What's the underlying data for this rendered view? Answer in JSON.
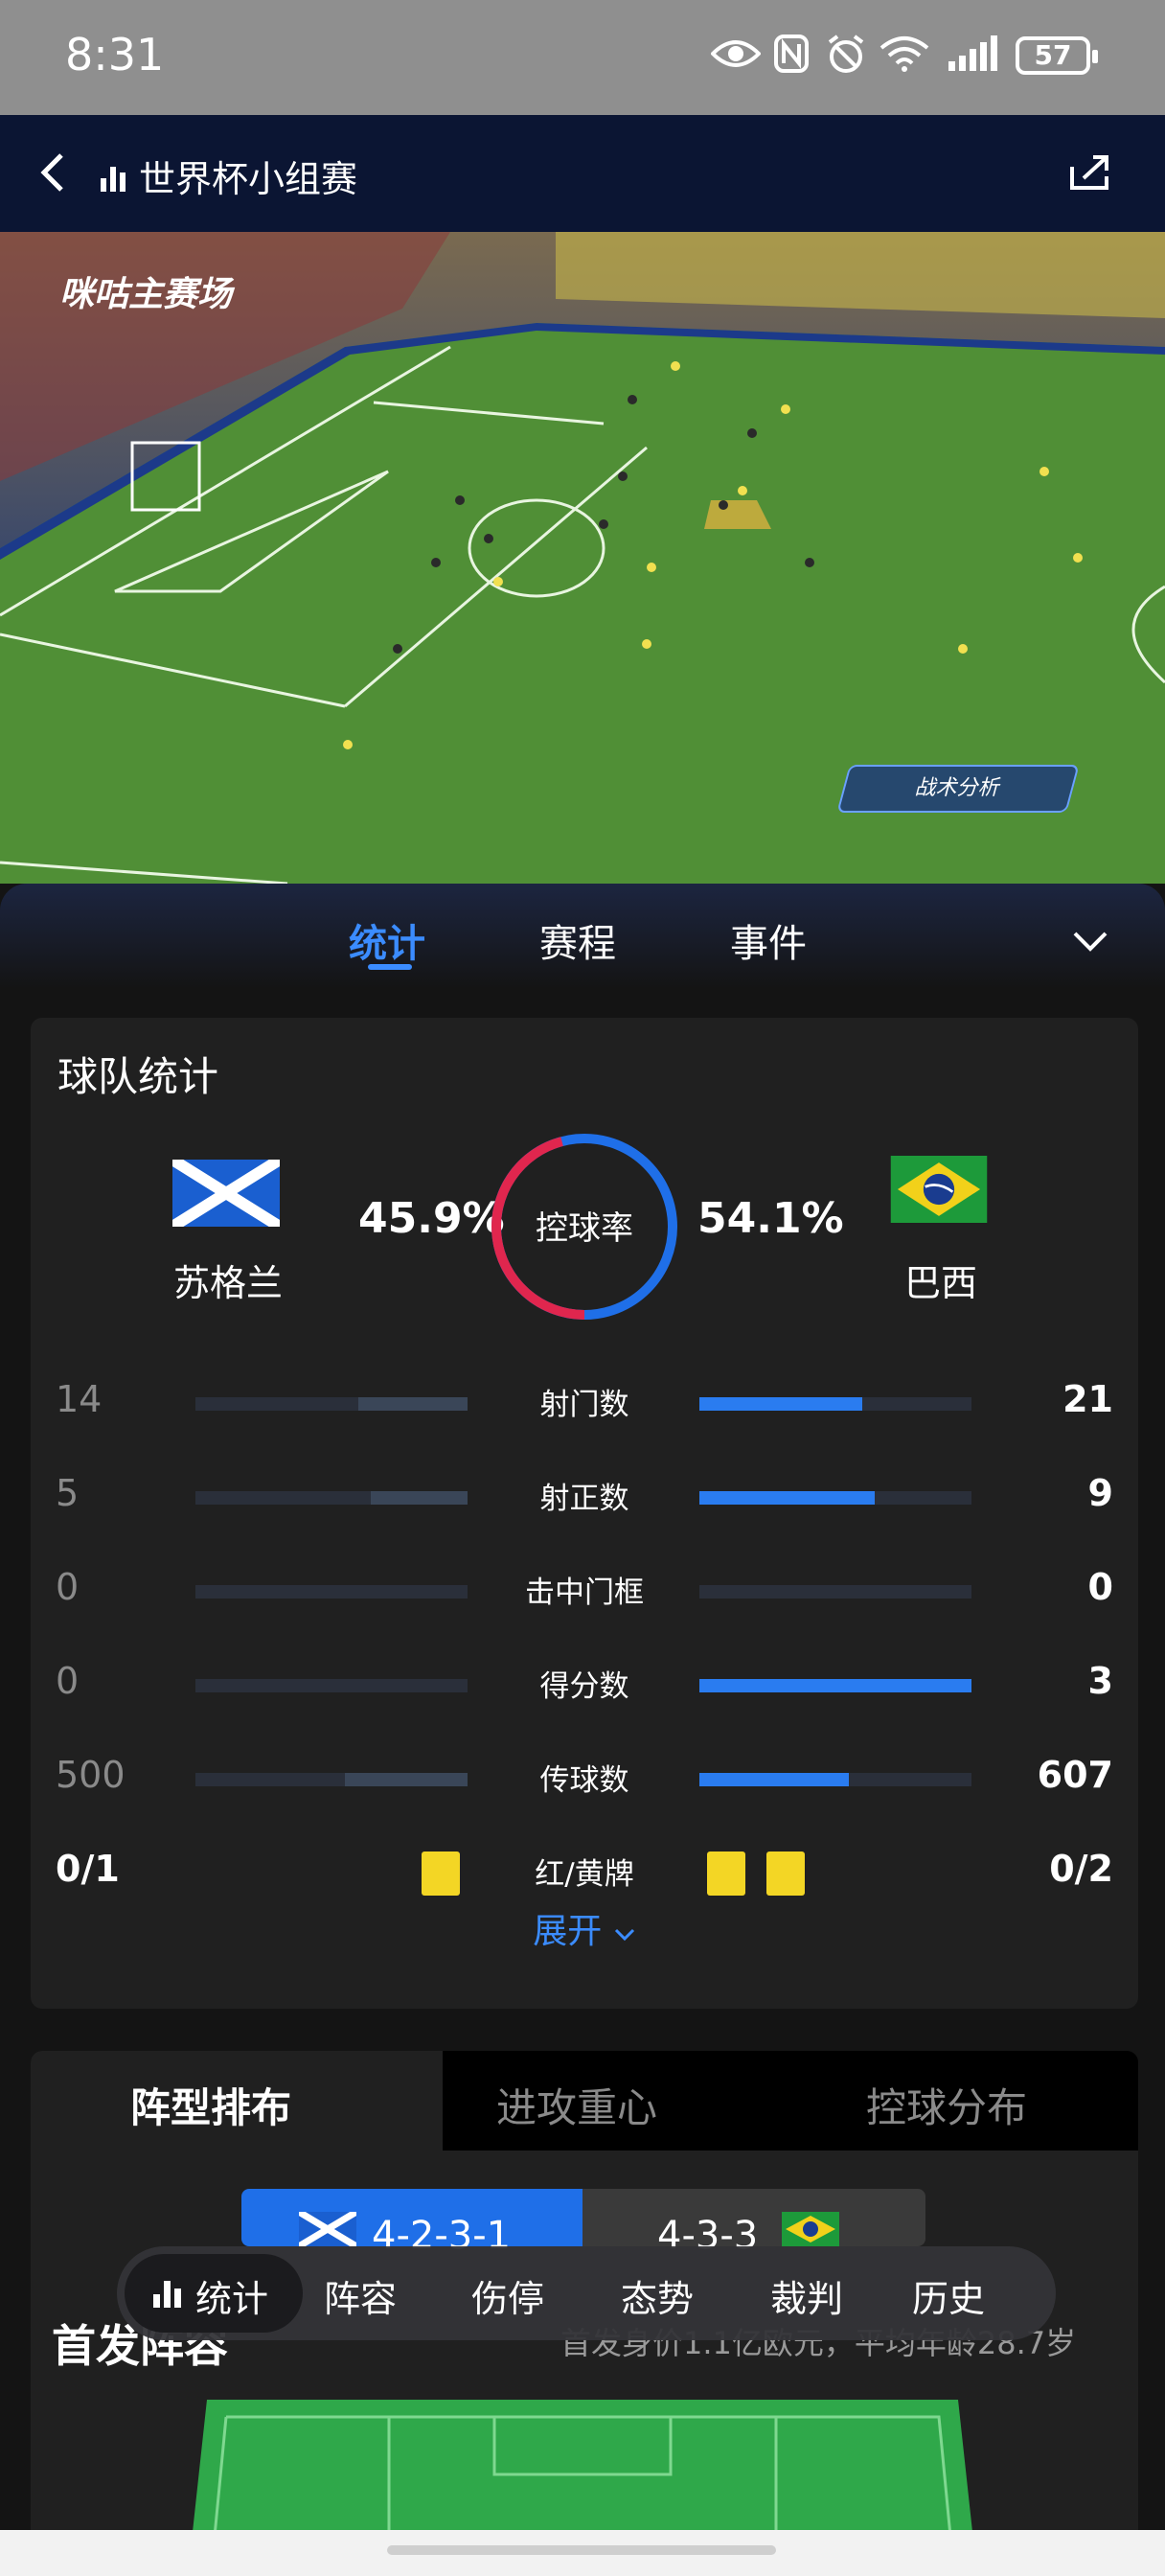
{
  "status_bar": {
    "time": "8:31",
    "battery": "57"
  },
  "nav": {
    "title": "世界杯小组赛"
  },
  "video": {
    "logo": "咪咕主赛场",
    "tactics_button": "战术分析"
  },
  "tabs": [
    "统计",
    "赛程",
    "事件"
  ],
  "team_stats": {
    "title": "球队统计",
    "home": {
      "name": "苏格兰",
      "possession": "45.9%"
    },
    "away": {
      "name": "巴西",
      "possession": "54.1%"
    },
    "possession_label": "控球率",
    "possession_fraction_home": 0.459,
    "rows": [
      {
        "label": "射门数",
        "home": "14",
        "away": "21",
        "home_fraction": 0.4,
        "away_fraction": 0.6
      },
      {
        "label": "射正数",
        "home": "5",
        "away": "9",
        "home_fraction": 0.357,
        "away_fraction": 0.643
      },
      {
        "label": "击中门框",
        "home": "0",
        "away": "0",
        "home_fraction": 0,
        "away_fraction": 0
      },
      {
        "label": "得分数",
        "home": "0",
        "away": "3",
        "home_fraction": 0,
        "away_fraction": 1
      },
      {
        "label": "传球数",
        "home": "500",
        "away": "607",
        "home_fraction": 0.452,
        "away_fraction": 0.548
      }
    ],
    "cards": {
      "label": "红/黄牌",
      "home": "0/1",
      "away": "0/2"
    },
    "expand_label": "展开"
  },
  "formation_tabs": [
    "阵型排布",
    "进攻重心",
    "控球分布"
  ],
  "formations": {
    "home": "4-2-3-1",
    "away": "4-3-3"
  },
  "lineup": {
    "title": "首发阵容",
    "subtitle": "首发身价1.1亿欧元，平均年龄28.7岁"
  },
  "bottom_nav": [
    "统计",
    "阵容",
    "伤停",
    "态势",
    "裁判",
    "历史"
  ],
  "colors": {
    "accent": "#3b8cff",
    "home_bar": "#3a4658",
    "away_bar": "#2a7cf0",
    "ring_home": "#e0264e",
    "ring_away": "#1f6fe8",
    "yellow_card": "#f3d625"
  }
}
